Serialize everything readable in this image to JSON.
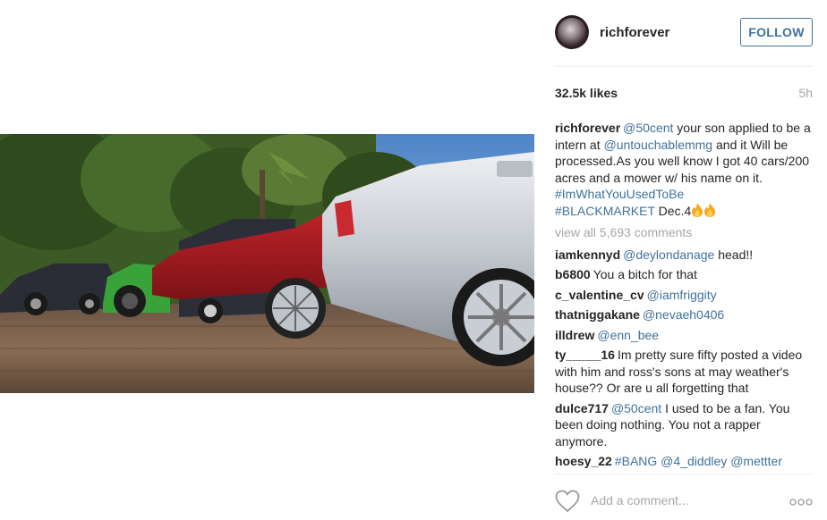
{
  "post": {
    "username": "richforever",
    "follow_label": "FOLLOW",
    "likes": "32.5k likes",
    "time": "5h",
    "view_all": "view all 5,693 comments",
    "add_comment_placeholder": "Add a comment...",
    "icons": [
      "avatar",
      "heart-icon",
      "more-options-icon",
      "fire-emoji"
    ]
  },
  "caption": {
    "user": "richforever",
    "mention": "@50cent",
    "text1": " your son applied to be a intern at ",
    "mention2": "@untouchablemmg",
    "text2": " and it Will be processed.As you well know I got 40 cars/200 acres and a mower w/ his name on it. ",
    "tag1": "#ImWhatYouUsedToBe",
    "tag2": "#BLACKMARKET",
    "text3": " Dec.4"
  },
  "comments": [
    {
      "user": "iamkennyd",
      "mention": "@deylondanage",
      "text": " head!!"
    },
    {
      "user": "b6800",
      "mention": "",
      "text": "You a bitch for that"
    },
    {
      "user": "c_valentine_cv",
      "mention": "@iamfriggity",
      "text": ""
    },
    {
      "user": "thatniggakane",
      "mention": "@nevaeh0406",
      "text": ""
    },
    {
      "user": "illdrew",
      "mention": "@enn_bee",
      "text": ""
    },
    {
      "user": "ty_____16",
      "mention": "",
      "text": "Im pretty sure fifty posted a video with him and ross's sons at may weather's house?? Or are u all forgetting that"
    },
    {
      "user": "dulce717",
      "mention": "@50cent",
      "text": " I used to be a fan. You been doing nothing. You not a rapper anymore."
    },
    {
      "user": "hoesy_22",
      "mention": "#BANG @4_diddley @mettter",
      "text": ""
    }
  ],
  "colors": {
    "link": "#3f729b",
    "muted": "#a5a7aa",
    "text": "#262626"
  }
}
